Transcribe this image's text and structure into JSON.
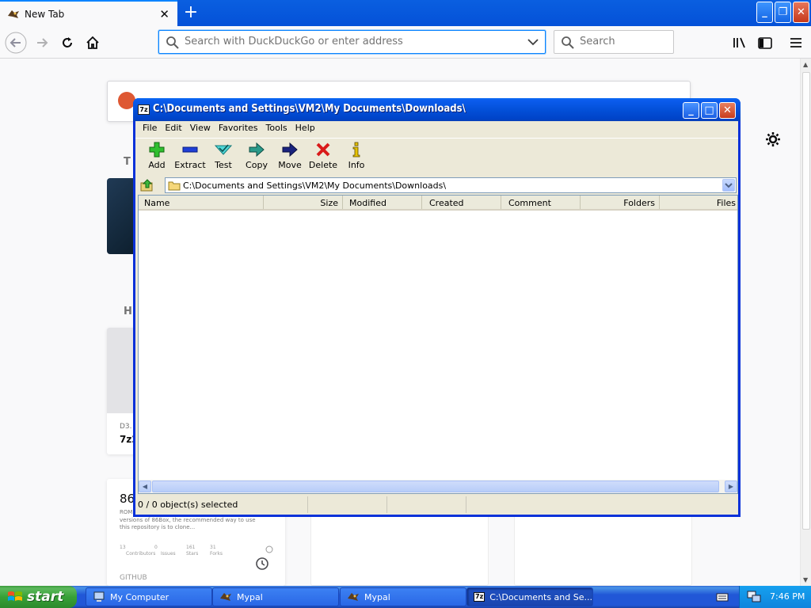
{
  "browser": {
    "tab_title": "New Tab",
    "new_tab_symbol": "+",
    "close_symbol": "✕",
    "url_placeholder": "Search with DuckDuckGo or enter address",
    "search_placeholder": "Search"
  },
  "newtab": {
    "top_sites_heading": "T",
    "highlights_heading": "H",
    "card1": {
      "source": "D3.",
      "title": "7z2"
    },
    "card2": {
      "title": "86",
      "desc1": "ROM",
      "desc2": "versions of 86Box, the recommended way to use",
      "desc3": "this repository is to clone...",
      "stat_contrib": "13",
      "stat_issues": "0",
      "stat_stars": "161",
      "stat_forks": "31",
      "stat_contrib_label": "Contributors",
      "stat_issues_label": "Issues",
      "stat_stars_label": "Stars",
      "stat_forks_label": "Forks",
      "source": "GITHUB"
    }
  },
  "zip": {
    "icon_label": "7z",
    "title": "C:\\Documents and Settings\\VM2\\My Documents\\Downloads\\",
    "menu": [
      "File",
      "Edit",
      "View",
      "Favorites",
      "Tools",
      "Help"
    ],
    "toolbar": [
      "Add",
      "Extract",
      "Test",
      "Copy",
      "Move",
      "Delete",
      "Info"
    ],
    "path": "C:\\Documents and Settings\\VM2\\My Documents\\Downloads\\",
    "columns": [
      "Name",
      "Size",
      "Modified",
      "Created",
      "Comment",
      "Folders",
      "Files"
    ],
    "status": "0 / 0 object(s) selected"
  },
  "taskbar": {
    "start": "start",
    "items": [
      "My Computer",
      "Mypal",
      "Mypal",
      "C:\\Documents and Se..."
    ],
    "clock": "7:46 PM"
  },
  "colors": {
    "xp_title_blue": "#0350d9",
    "taskbar_blue": "#2157d7",
    "start_green": "#37a137",
    "firefox_focus": "#0a84ff"
  }
}
